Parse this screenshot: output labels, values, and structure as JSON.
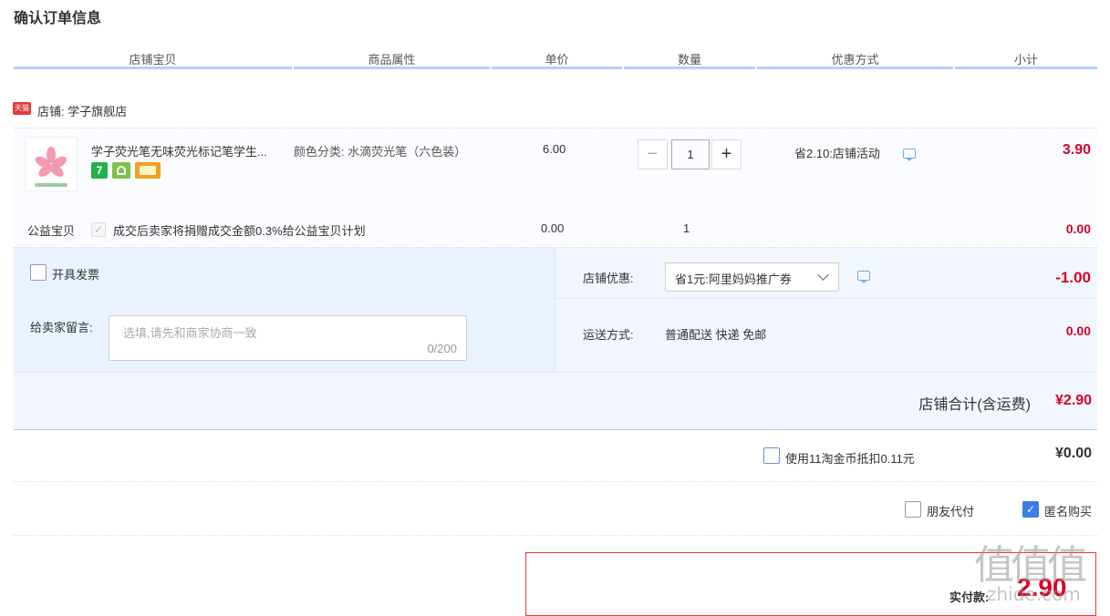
{
  "page_title": "确认订单信息",
  "columns": [
    "店铺宝贝",
    "商品属性",
    "单价",
    "数量",
    "优惠方式",
    "小计"
  ],
  "shop": {
    "tag": "天猫",
    "label": "店铺: 学子旗舰店"
  },
  "item": {
    "name": "学子荧光笔无味荧光标记笔学生...",
    "attribute": "颜色分类: 水滴荧光笔（六色装）",
    "price": "6.00",
    "quantity": "1",
    "minus": "−",
    "plus": "+",
    "badge_1": "7",
    "promo": "省2.10:店铺活动",
    "subtotal": "3.90"
  },
  "charity": {
    "label": "公益宝贝",
    "checkmark": "✓",
    "text": "成交后卖家将捐赠成交金额0.3%给公益宝贝计划",
    "price": "0.00",
    "quantity": "1",
    "subtotal": "0.00"
  },
  "invoice": {
    "label": "开具发票"
  },
  "message": {
    "label": "给卖家留言:",
    "placeholder": "选填,请先和商家协商一致",
    "counter": "0/200"
  },
  "shop_discount": {
    "label": "店铺优惠:",
    "selected": "省1元:阿里妈妈推广券",
    "amount": "-1.00"
  },
  "shipping": {
    "label": "运送方式:",
    "value": "普通配送 快递 免邮",
    "amount": "0.00"
  },
  "shop_total": {
    "label": "店铺合计(含运费)",
    "amount": "¥2.90"
  },
  "coins": {
    "label": "使用11淘金币抵扣0.11元",
    "amount": "¥0.00"
  },
  "friend_pay": {
    "label": "朋友代付"
  },
  "anonymous": {
    "label": "匿名购买",
    "checkmark": "✓"
  },
  "final": {
    "label": "实付款:",
    "amount": "2.90"
  },
  "watermark": {
    "glyphs": "值值值",
    "site": "zhide.com"
  },
  "colors": {
    "accent_red": "#d70026",
    "header_bar": "#b2d1ff",
    "check_blue": "#3b7ee8"
  }
}
